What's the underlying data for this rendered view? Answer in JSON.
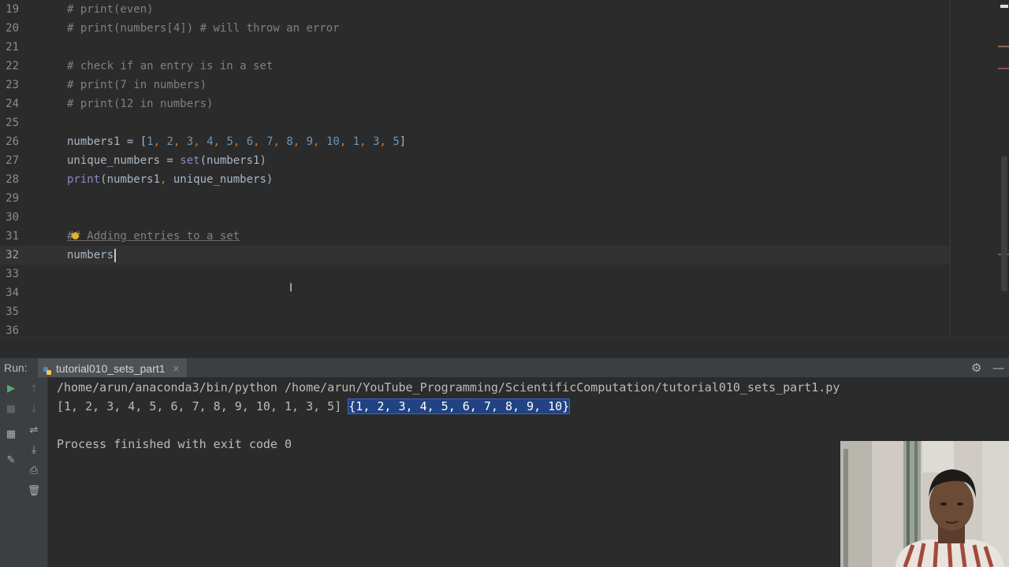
{
  "editor": {
    "lines": [
      {
        "num": "19",
        "text": "# print(even)"
      },
      {
        "num": "20",
        "text": "# print(numbers[4]) # will throw an error"
      },
      {
        "num": "21",
        "text": ""
      },
      {
        "num": "22",
        "text": "# check if an entry is in a set"
      },
      {
        "num": "23",
        "text": "# print(7 in numbers)"
      },
      {
        "num": "24",
        "text": "# print(12 in numbers)"
      },
      {
        "num": "25",
        "text": ""
      },
      {
        "num": "26",
        "text": "numbers1 = [1, 2, 3, 4, 5, 6, 7, 8, 9, 10, 1, 3, 5]"
      },
      {
        "num": "27",
        "text": "unique_numbers = set(numbers1)"
      },
      {
        "num": "28",
        "text": "print(numbers1, unique_numbers)"
      },
      {
        "num": "29",
        "text": ""
      },
      {
        "num": "30",
        "text": ""
      },
      {
        "num": "31",
        "text": "## Adding entries to a set"
      },
      {
        "num": "32",
        "text": "numbers"
      },
      {
        "num": "33",
        "text": ""
      },
      {
        "num": "34",
        "text": ""
      },
      {
        "num": "35",
        "text": ""
      },
      {
        "num": "36",
        "text": ""
      }
    ]
  },
  "run_panel": {
    "label": "Run:",
    "tab_label": "tutorial010_sets_part1",
    "tab_close": "×",
    "console": {
      "command": "/home/arun/anaconda3/bin/python /home/arun/YouTube_Programming/ScientificComputation/tutorial010_sets_part1.py",
      "output_list": "[1, 2, 3, 4, 5, 6, 7, 8, 9, 10, 1, 3, 5]",
      "output_set": "{1, 2, 3, 4, 5, 6, 7, 8, 9, 10}",
      "exit_message": "Process finished with exit code 0"
    },
    "icons": [
      "rerun-icon",
      "stop-icon",
      "up-arrow-icon",
      "down-arrow-icon",
      "layout-icon",
      "soft-wrap-icon",
      "pin-icon",
      "scroll-to-end-icon",
      "print-icon",
      "trash-icon",
      "gear-icon",
      "minimize-icon"
    ]
  },
  "colors": {
    "editor_bg": "#2b2b2b",
    "panel_bg": "#3c3f41",
    "comment": "#808080",
    "number": "#6897bb",
    "keyword": "#cc7832",
    "builtin": "#8888c6",
    "text": "#a9b7c6",
    "selection": "#214283"
  }
}
